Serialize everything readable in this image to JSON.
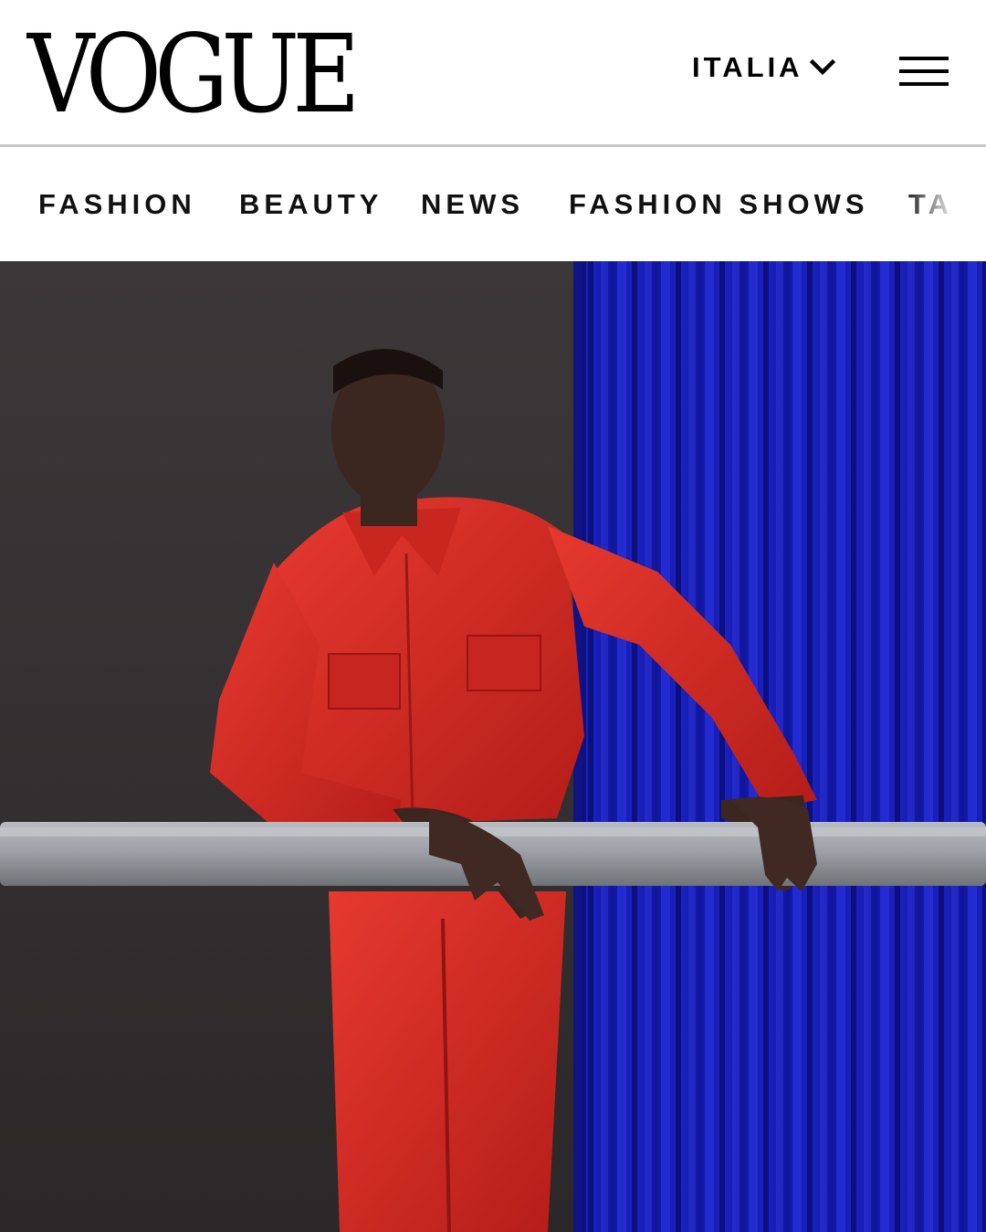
{
  "header": {
    "logo_text": "VOGUE",
    "edition_label": "ITALIA",
    "edition_icon": "chevron-down-icon",
    "menu_icon": "hamburger-menu-icon"
  },
  "nav": {
    "items": [
      {
        "label": "FASHION"
      },
      {
        "label": "BEAUTY"
      },
      {
        "label": "NEWS"
      },
      {
        "label": "FASHION SHOWS"
      },
      {
        "label": "TA"
      }
    ]
  },
  "hero": {
    "image": "photo of a man in a red leather shirt and red trousers leaning on a grey bar in front of a blue velvet curtain"
  },
  "colors": {
    "background": "#ffffff",
    "text": "#000000",
    "divider": "#c9c9c9",
    "backdrop": "#3a3536",
    "curtain": "#1a1fb8",
    "outfit_red": "#d62b24",
    "bar_grey": "#9a9ea3"
  }
}
